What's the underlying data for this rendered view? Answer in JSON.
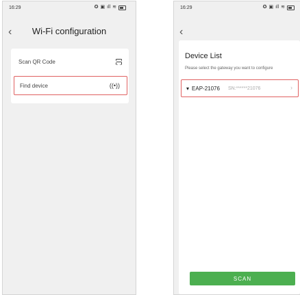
{
  "left_screen": {
    "status_time": "16:29",
    "status_icons": "✪ ▣ ⁴ᴳ ᵢₗ ✦",
    "title": "Wi-Fi configuration",
    "menu": [
      {
        "label": "Scan QR Code",
        "icon": "scan-icon"
      },
      {
        "label": "Find device",
        "icon": "radio-signal-icon",
        "icon_glyph": "((•))"
      }
    ]
  },
  "right_screen": {
    "status_time": "16:29",
    "status_icons": "✪ ▣ ⁴ᴳ ᵢₗ ✦",
    "device_list_title": "Device List",
    "device_list_subtitle": "Please select the gateway you want to configure",
    "devices": [
      {
        "name": "EAP-21076",
        "sn": "SN:******21076"
      }
    ],
    "scan_button_label": "SCAN"
  },
  "colors": {
    "accent_green": "#4caf50",
    "highlight_red": "#e06060",
    "background_gray": "#f0f0f0"
  }
}
